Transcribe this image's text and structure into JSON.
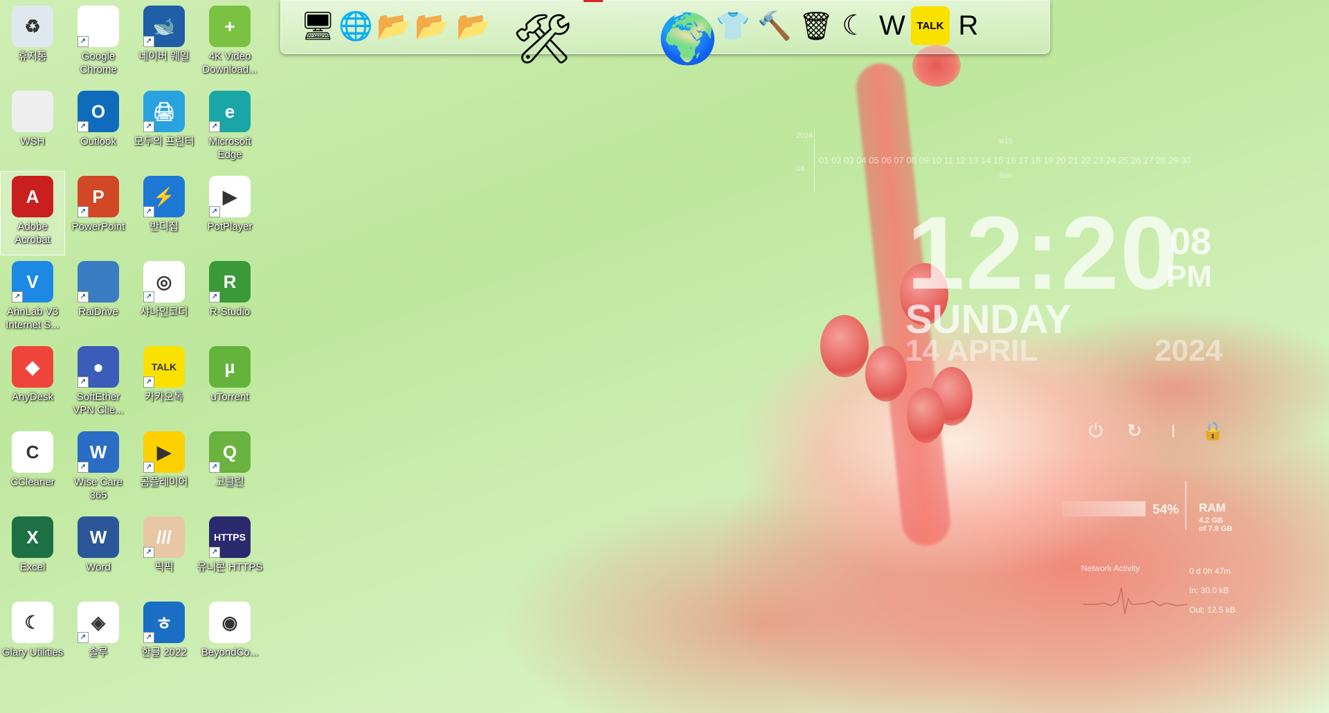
{
  "desktop_icons": [
    {
      "label": "휴지통",
      "color": "#dfe8ee",
      "glyph": "♻",
      "shortcut": false,
      "icon": "recycle-bin-icon"
    },
    {
      "label": "Google Chrome",
      "color": "#ffffff",
      "glyph": "",
      "shortcut": true,
      "icon": "chrome-icon"
    },
    {
      "label": "네이버 웨일",
      "color": "#1f5fa8",
      "glyph": "🐋",
      "shortcut": true,
      "icon": "whale-browser-icon"
    },
    {
      "label": "4K Video Download...",
      "color": "#7cc242",
      "glyph": "+",
      "shortcut": false,
      "icon": "cloud-download-icon"
    },
    {
      "label": "WSH",
      "color": "#eeeeee",
      "glyph": "",
      "shortcut": false,
      "icon": "script-file-icon"
    },
    {
      "label": "Outlook",
      "color": "#0f6cbd",
      "glyph": "O",
      "shortcut": true,
      "icon": "outlook-icon"
    },
    {
      "label": "모두의 프린터",
      "color": "#29a3e0",
      "glyph": "🖨",
      "shortcut": true,
      "icon": "printer-icon"
    },
    {
      "label": "Microsoft Edge",
      "color": "#1aa6a6",
      "glyph": "e",
      "shortcut": true,
      "icon": "edge-icon"
    },
    {
      "label": "Adobe Acrobat",
      "color": "#c91f1f",
      "glyph": "A",
      "shortcut": false,
      "icon": "acrobat-icon",
      "selected": true
    },
    {
      "label": "PowerPoint",
      "color": "#d24726",
      "glyph": "P",
      "shortcut": true,
      "icon": "powerpoint-icon"
    },
    {
      "label": "반디집",
      "color": "#1e78d6",
      "glyph": "⚡",
      "shortcut": true,
      "icon": "bandizip-icon"
    },
    {
      "label": "PotPlayer",
      "color": "#ffffff",
      "glyph": "▶",
      "shortcut": true,
      "icon": "potplayer-icon"
    },
    {
      "label": "AhnLab V3 Internet S...",
      "color": "#1e88e5",
      "glyph": "V",
      "shortcut": true,
      "icon": "v3-icon"
    },
    {
      "label": "RaiDrive",
      "color": "#3a7cc2",
      "glyph": "",
      "shortcut": true,
      "icon": "raidrive-icon"
    },
    {
      "label": "샤나인코더",
      "color": "#ffffff",
      "glyph": "◎",
      "shortcut": true,
      "icon": "shana-encoder-icon"
    },
    {
      "label": "R-Studio",
      "color": "#3a9a3a",
      "glyph": "R",
      "shortcut": true,
      "icon": "r-studio-icon"
    },
    {
      "label": "AnyDesk",
      "color": "#ef443b",
      "glyph": "◆",
      "shortcut": false,
      "icon": "anydesk-icon"
    },
    {
      "label": "SoftEther VPN Clie...",
      "color": "#3b5cb8",
      "glyph": "●",
      "shortcut": true,
      "icon": "softether-icon"
    },
    {
      "label": "카카오톡",
      "color": "#fae100",
      "glyph": "TALK",
      "shortcut": true,
      "icon": "kakaotalk-icon"
    },
    {
      "label": "uTorrent",
      "color": "#64b43c",
      "glyph": "µ",
      "shortcut": false,
      "icon": "utorrent-icon"
    },
    {
      "label": "CCleaner",
      "color": "#ffffff",
      "glyph": "C",
      "shortcut": false,
      "icon": "ccleaner-icon"
    },
    {
      "label": "Wise Care 365",
      "color": "#2b6cc4",
      "glyph": "W",
      "shortcut": true,
      "icon": "wise-care-icon"
    },
    {
      "label": "곰플레이어",
      "color": "#ffd000",
      "glyph": "▶",
      "shortcut": true,
      "icon": "gom-player-icon"
    },
    {
      "label": "고클린",
      "color": "#6ab33e",
      "glyph": "Q",
      "shortcut": true,
      "icon": "goclean-icon"
    },
    {
      "label": "Excel",
      "color": "#1d7044",
      "glyph": "X",
      "shortcut": false,
      "icon": "excel-icon"
    },
    {
      "label": "Word",
      "color": "#2b579a",
      "glyph": "W",
      "shortcut": false,
      "icon": "word-icon"
    },
    {
      "label": "픽픽",
      "color": "#e8c7a5",
      "glyph": "///",
      "shortcut": true,
      "icon": "picpick-icon"
    },
    {
      "label": "유니콘 HTTPS",
      "color": "#2b2a6e",
      "glyph": "HTTPS",
      "shortcut": true,
      "icon": "unicorn-https-icon"
    },
    {
      "label": "Glary Utilities",
      "color": "#ffffff",
      "glyph": "☾",
      "shortcut": false,
      "icon": "glary-utilities-icon"
    },
    {
      "label": "솔루",
      "color": "#ffffff",
      "glyph": "◈",
      "shortcut": true,
      "icon": "solu-icon"
    },
    {
      "label": "한글 2022",
      "color": "#1a6fc4",
      "glyph": "ㅎ",
      "shortcut": true,
      "icon": "hangul-icon"
    },
    {
      "label": "BeyondCo...",
      "color": "#ffffff",
      "glyph": "◉",
      "shortcut": false,
      "icon": "beyond-compare-icon"
    }
  ],
  "dock_items": [
    {
      "icon": "computer-icon",
      "glyph": "🖥"
    },
    {
      "icon": "network-globe-icon",
      "glyph": "🌐"
    },
    {
      "icon": "folder-icon",
      "glyph": "📂"
    },
    {
      "icon": "folder-icon",
      "glyph": "📂"
    },
    {
      "icon": "folder-open-icon",
      "glyph": "📂"
    },
    {
      "icon": "tools-icon",
      "glyph": "🛠"
    },
    {
      "icon": "globe-icon",
      "glyph": "🌍"
    },
    {
      "icon": "tshirt-icon",
      "glyph": "👕"
    },
    {
      "icon": "hammer-icon",
      "glyph": "🔨"
    },
    {
      "icon": "recycle-bin-icon",
      "glyph": "🗑"
    },
    {
      "icon": "glary-moon-icon",
      "glyph": "☾"
    },
    {
      "icon": "wise-shield-icon",
      "glyph": "W"
    },
    {
      "icon": "kakaotalk-icon",
      "glyph": "TALK"
    },
    {
      "icon": "recovery-icon",
      "glyph": "R"
    }
  ],
  "clock": {
    "time": "12:20",
    "seconds": "08",
    "ampm": "PM",
    "day": "SUNDAY",
    "date": "14 APRIL",
    "year": "2024"
  },
  "calendar": {
    "year": "2024",
    "month_short": "04",
    "week": "w15",
    "day_label": "Sun",
    "days": "01 02 03 04 05 06 07 08 09 10 11 12 13 14 15 16 17 18 19 20 21 22 23 24 25 26 27 28 29 30"
  },
  "power": {
    "shutdown": "⏻",
    "restart": "↻",
    "sleep": "⏽",
    "lock": "🔒"
  },
  "ram": {
    "percent": "54%",
    "label": "RAM",
    "used": "4.2 GB",
    "total": "of 7.8 GB"
  },
  "network": {
    "title": "Network Activity",
    "uptime": "0 d 0h 47m",
    "in": "In: 30.0 kB",
    "out": "Out: 12.5 kB"
  }
}
